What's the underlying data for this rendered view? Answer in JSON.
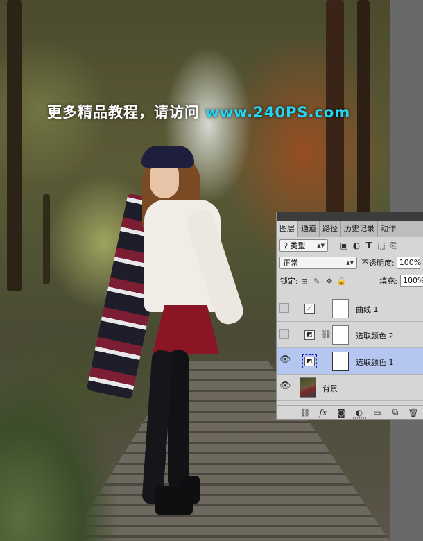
{
  "watermark": {
    "text": "更多精品教程，请访问",
    "url": "www.240PS.com"
  },
  "panel": {
    "tabs": [
      "图层",
      "通道",
      "路径",
      "历史记录",
      "动作"
    ],
    "filter_kind": "类型",
    "blend_mode": "正常",
    "opacity_label": "不透明度:",
    "opacity_value": "100%",
    "lock_label": "锁定:",
    "fill_label": "填充:",
    "fill_value": "100%",
    "layers": [
      {
        "name": "曲线 1",
        "visible": false,
        "type": "curves",
        "icon": "curves-adjustment-icon"
      },
      {
        "name": "选取颜色 2",
        "visible": false,
        "type": "selective-color",
        "icon": "selective-color-icon",
        "linked": true
      },
      {
        "name": "选取颜色 1",
        "visible": true,
        "type": "selective-color",
        "icon": "selective-color-icon",
        "selected": true
      },
      {
        "name": "背景",
        "visible": true,
        "type": "background"
      }
    ],
    "colors": {
      "selected_row": "#b5c7f0",
      "panel_bg": "#d6d6d6",
      "url_color": "#22d8f5"
    }
  }
}
